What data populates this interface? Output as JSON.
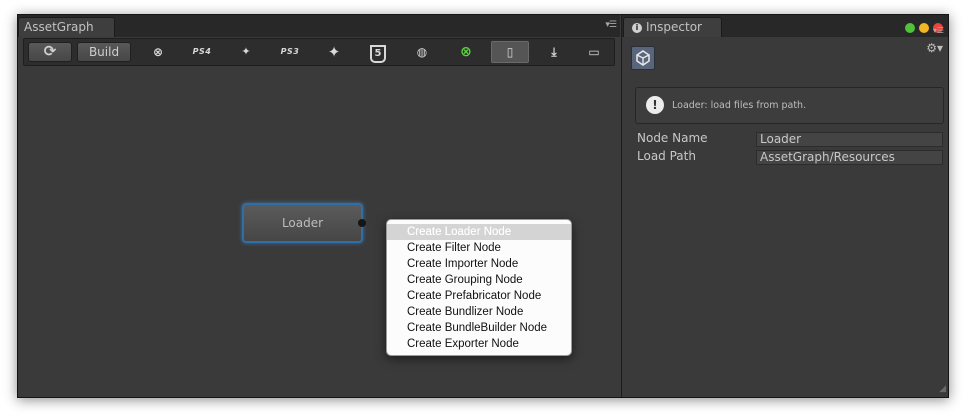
{
  "asset_graph": {
    "tab_title": "AssetGraph",
    "tab_menu_icon": "tab-menu-icon",
    "toolbar": {
      "refresh_icon": "refresh-icon",
      "build_label": "Build",
      "platforms": [
        {
          "id": "xbox360",
          "glyph": "⊗",
          "icon": "xbox-icon"
        },
        {
          "id": "ps4",
          "glyph": "PS4",
          "icon": "ps4-icon"
        },
        {
          "id": "android",
          "glyph": "🤖",
          "icon": "android-icon"
        },
        {
          "id": "ps3",
          "glyph": "PS3",
          "icon": "ps3-icon"
        },
        {
          "id": "blackberry",
          "glyph": "✦",
          "icon": "blackberry-icon"
        },
        {
          "id": "html5",
          "glyph": "5",
          "icon": "html5-icon"
        },
        {
          "id": "web",
          "glyph": "◍",
          "icon": "globe-icon"
        },
        {
          "id": "xboxone",
          "glyph": "⊗",
          "icon": "xbox-one-icon"
        },
        {
          "id": "mobile",
          "glyph": "▯",
          "icon": "mobile-icon"
        },
        {
          "id": "download",
          "glyph": "⤓",
          "icon": "download-icon"
        },
        {
          "id": "standalone",
          "glyph": "▭",
          "icon": "standalone-icon"
        }
      ]
    },
    "node": {
      "label": "Loader"
    },
    "context_menu": {
      "items": [
        "Create Loader Node",
        "Create Filter Node",
        "Create Importer Node",
        "Create Grouping Node",
        "Create Prefabricator Node",
        "Create Bundlizer Node",
        "Create BundleBuilder Node",
        "Create Exporter Node"
      ],
      "highlighted_index": 0
    }
  },
  "inspector": {
    "tab_title": "Inspector",
    "help_message": "Loader: load files from path.",
    "properties": [
      {
        "label": "Node Name",
        "value": "Loader"
      },
      {
        "label": "Load Path",
        "value": "AssetGraph/Resources"
      }
    ]
  },
  "colors": {
    "window_bg": "#3a3a3a",
    "node_border": "#2f6fa8",
    "light_green": "#4fc23a",
    "light_yellow": "#f0b626",
    "light_red": "#e8453c",
    "platform_active_green": "#5bd142"
  }
}
